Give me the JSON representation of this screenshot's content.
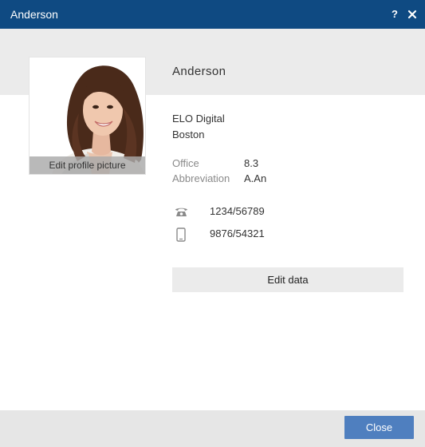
{
  "window": {
    "title": "Anderson",
    "help_label": "?",
    "close_icon": "close-icon"
  },
  "profile": {
    "name": "Anderson",
    "edit_picture_label": "Edit profile picture",
    "company": "ELO Digital",
    "city": "Boston",
    "office_label": "Office",
    "office_value": "8.3",
    "abbreviation_label": "Abbreviation",
    "abbreviation_value": "A.An",
    "phone_icon": "telephone-icon",
    "phone": "1234/56789",
    "mobile_icon": "mobile-phone-icon",
    "mobile": "9876/54321",
    "edit_data_label": "Edit data"
  },
  "footer": {
    "close_label": "Close"
  },
  "colors": {
    "titlebar": "#0f4a82",
    "header_band": "#ebebeb",
    "primary_button": "#4f7fbf",
    "secondary_button": "#ebebeb",
    "footer": "#e6e6e6"
  }
}
